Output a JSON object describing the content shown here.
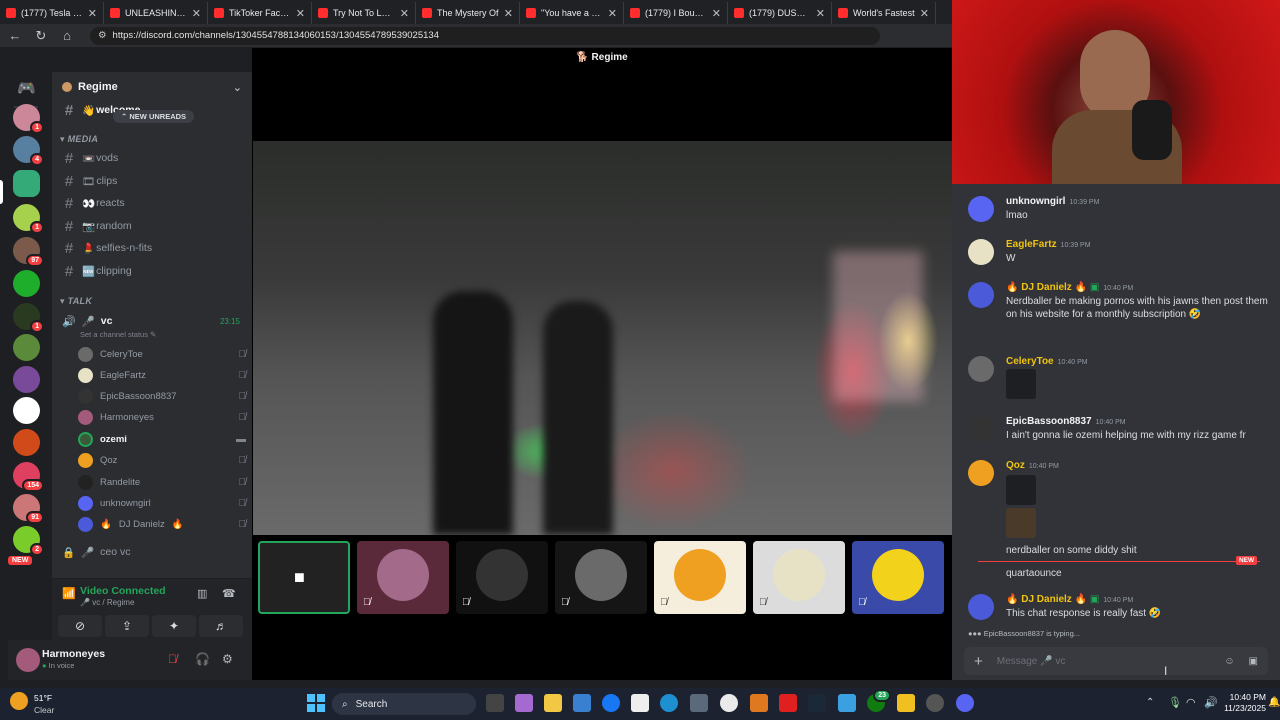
{
  "browser": {
    "tabs": [
      "(1777) Tesla Glue",
      "UNLEASHING on",
      "TikToker Facing",
      "Try Not To Laugh",
      "The Mystery Of",
      "\"You have a right",
      "(1779) I Bought a",
      "(1779) DUST - Yo",
      "World's Fastest",
      ""
    ],
    "url": "https://discord.com/channels/1304554788134060153/1304554789539025134"
  },
  "server": {
    "name": "Regime",
    "rail_badges": [
      "1",
      "4",
      "",
      "1",
      "97",
      "",
      "1",
      "",
      "",
      "",
      "",
      "154",
      "91",
      "2",
      "NEW"
    ],
    "text_channels": [
      {
        "name": "welcome",
        "emoji": "👋"
      },
      {
        "name": "vods",
        "emoji": "📼"
      },
      {
        "name": "clips",
        "emoji": "🎞"
      },
      {
        "name": "reacts",
        "emoji": "👀"
      },
      {
        "name": "random",
        "emoji": "📷"
      },
      {
        "name": "selfies-n-fits",
        "emoji": "💄"
      },
      {
        "name": "clipping",
        "emoji": "🆕"
      }
    ],
    "new_unreads": "NEW UNREADS",
    "category_media": "MEDIA",
    "category_talk": "TALK",
    "voice_channel": "vc",
    "voice_timer": "23:15",
    "channel_status": "Set a channel status",
    "voice_users": [
      "CeleryToe",
      "EagleFartz",
      "EpicBassoon8837",
      "Harmoneyes",
      "ozemi",
      "Qoz",
      "Randelite",
      "unknowngirl",
      "DJ Danielz"
    ],
    "locked_channel": "ceo vc",
    "video_connected": "Video Connected",
    "voice_path": "vc / Regime",
    "user": {
      "name": "Harmoneyes",
      "status": "In voice"
    }
  },
  "stage": {
    "title": "Regime"
  },
  "chat": {
    "messages": [
      {
        "author": "unknowngirl",
        "time": "10:39 PM",
        "text": "lmao",
        "color": "#f2f3f5"
      },
      {
        "author": "EagleFartz",
        "time": "10:39 PM",
        "text": "W",
        "color": "#f1c40f"
      },
      {
        "author": "DJ Danielz",
        "time": "10:40 PM",
        "text": "Nerdballer be making pornos with his jawns then post them on his website for a monthly subscription 🤣",
        "color": "#f1c40f"
      },
      {
        "author": "CeleryToe",
        "time": "10:40 PM",
        "text": "",
        "color": "#f1c40f"
      },
      {
        "author": "EpicBassoon8837",
        "time": "10:40 PM",
        "text": "I ain't gonna lie ozemi helping me with my rizz game fr",
        "color": "#f2f3f5"
      },
      {
        "author": "Qoz",
        "time": "10:40 PM",
        "text": "nerdballer on some diddy shit",
        "color": "#f1c40f"
      },
      {
        "author": "",
        "time": "",
        "text": "quartaounce",
        "color": "#f2f3f5"
      },
      {
        "author": "DJ Danielz",
        "time": "10:40 PM",
        "text": "This chat response is really fast 🤣",
        "color": "#f1c40f"
      }
    ],
    "new_label": "NEW",
    "typing": "EpicBassoon8837 is typing...",
    "composer_placeholder": "Message 🎤 vc"
  },
  "taskbar": {
    "weather_temp": "51°F",
    "weather_desc": "Clear",
    "search": "Search",
    "time": "10:40 PM",
    "date": "11/23/2025",
    "notif_count": "23"
  }
}
